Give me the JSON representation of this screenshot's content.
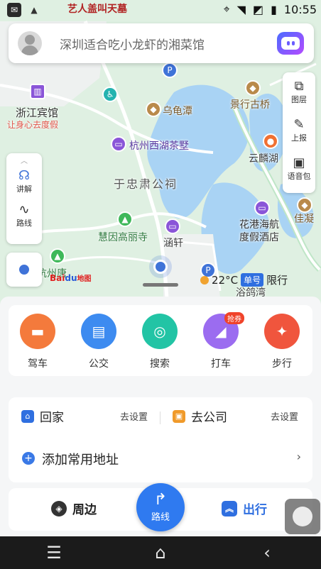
{
  "status_bar": {
    "title": "艺人盖叫天墓",
    "time": "10:55",
    "left_icons": [
      "message-icon",
      "android-icon"
    ],
    "right_icons": [
      "location-icon",
      "wifi-icon",
      "no-signal-icon",
      "battery-icon"
    ]
  },
  "search": {
    "placeholder": "深圳适合吃小龙虾的湘菜馆"
  },
  "map": {
    "labels": {
      "zhejiang_hotel": "浙江宾馆",
      "zhejiang_hotel_sub": "让身心去度假",
      "wuguitan": "乌龟潭",
      "jingxing_bridge": "景行古桥",
      "west_lake_villa": "杭州西湖茶墅",
      "yunqi": "云麟湖",
      "yu_qian_temple": "于忠肃公祠",
      "huagang_hotel_1": "花港海航",
      "huagang_hotel_2": "度假酒店",
      "jiaxing": "佳凝",
      "huiyin_temple": "慧因高丽寺",
      "hanxuan": "涵轩",
      "hangzhou_tang": "杭州唐",
      "yuge_bay": "浴鸽湾"
    },
    "baidu_logo": {
      "bai": "Bai",
      "du": "du",
      "map": "地图"
    },
    "weather": {
      "temperature": "22°C",
      "plate_badge": "单号",
      "restriction": "限行"
    }
  },
  "right_tools": [
    {
      "label": "图层",
      "icon": "layers-icon"
    },
    {
      "label": "上报",
      "icon": "report-icon"
    },
    {
      "label": "语音包",
      "icon": "voice-pack-icon"
    }
  ],
  "left_tools": [
    {
      "label": "讲解",
      "icon": "headphones-icon"
    },
    {
      "label": "路线",
      "icon": "route-icon"
    }
  ],
  "quick_actions": [
    {
      "label": "驾车",
      "color": "#f47a3c",
      "icon": "car-icon"
    },
    {
      "label": "公交",
      "color": "#3d8bf0",
      "icon": "bus-icon"
    },
    {
      "label": "搜索",
      "color": "#22c4a5",
      "icon": "search-icon"
    },
    {
      "label": "打车",
      "color": "#9b6cf0",
      "icon": "taxi-icon",
      "tag": "抢券"
    },
    {
      "label": "步行",
      "color": "#f0553d",
      "icon": "walk-icon"
    }
  ],
  "addresses": {
    "home_label": "回家",
    "home_set": "去设置",
    "company_label": "去公司",
    "company_set": "去设置",
    "add_common": "添加常用地址"
  },
  "tabs": {
    "nearby": "周边",
    "route": "路线",
    "travel": "出行"
  }
}
